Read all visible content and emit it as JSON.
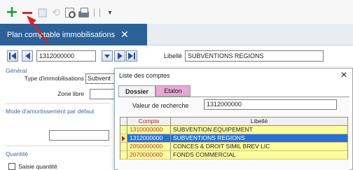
{
  "toolbar": {
    "items": [
      {
        "name": "plus-icon",
        "color": "#1e9e32"
      },
      {
        "name": "minus-icon",
        "color": "#d8282a"
      },
      {
        "name": "save-icon"
      },
      {
        "name": "undo-icon"
      },
      {
        "name": "search-icon"
      },
      {
        "name": "print-icon"
      },
      {
        "name": "chevron-down-icon"
      }
    ],
    "plus_glyph": "+",
    "dropdown_glyph": "▾"
  },
  "tabs": [
    {
      "label": "Plan comptable immobilisations",
      "active": true,
      "close_glyph": "✕"
    }
  ],
  "form": {
    "account_value": "1312000000",
    "libelle_label": "Libellé",
    "libelle_value": "SUBVENTIONS REGIONS",
    "general": {
      "section_title": "Général",
      "type_label": "Type d'immobilisations",
      "type_value": "Subvent",
      "zone_label": "Zone libre",
      "zone_value": ""
    },
    "amortissement": {
      "section_title": "Mode d'amortissement par défaut",
      "value": ""
    },
    "quantite": {
      "section_title": "Quantité",
      "checkbox_label": "Saisie quantité",
      "checked": false
    }
  },
  "dialog": {
    "title": "Liste des comptes",
    "close_glyph": "✕",
    "tabs": [
      {
        "label": "Dossier",
        "active": true
      },
      {
        "label": "Etalon",
        "active": false,
        "color": "#e7a9d5"
      }
    ],
    "search_label": "Valeur de recherche",
    "search_value": "1312000000",
    "columns": [
      "Compte",
      "Libellé"
    ],
    "rows": [
      {
        "compte": "1310000000",
        "libelle": "SUBVENTION EQUIPEMENT",
        "selected": false
      },
      {
        "compte": "1312000000",
        "libelle": "SUBVENTIONS REGIONS",
        "selected": true
      },
      {
        "compte": "2050000000",
        "libelle": "CONCES & DROIT SIMIL BREV LIC",
        "selected": false
      },
      {
        "compte": "2070000000",
        "libelle": "FONDS COMMERCIAL",
        "selected": false
      }
    ],
    "row_color": "#fdfd9c",
    "selected_color": "#2a6fd8"
  }
}
